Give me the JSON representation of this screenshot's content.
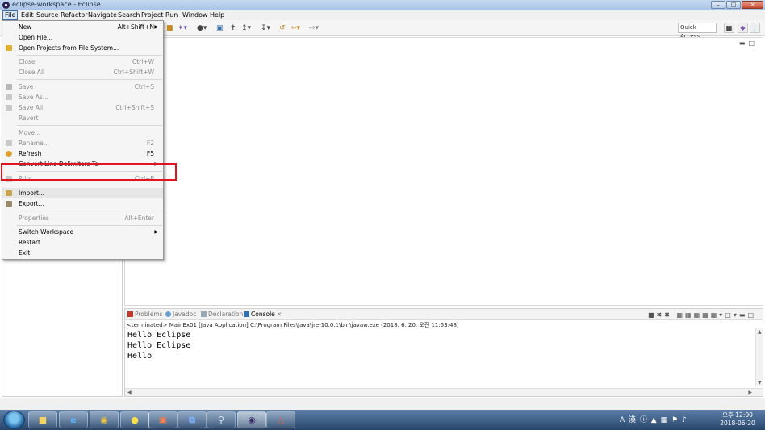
{
  "window": {
    "title": "eclipse-workspace - Eclipse"
  },
  "menubar": [
    "File",
    "Edit",
    "Source",
    "Refactor",
    "Navigate",
    "Search",
    "Project",
    "Run",
    "Window",
    "Help"
  ],
  "toolbar": {
    "quick_access": "Quick Access"
  },
  "file_menu": [
    {
      "label": "New",
      "shortcut": "Alt+Shift+N",
      "submenu": true,
      "disabled": false
    },
    {
      "label": "Open File...",
      "shortcut": "",
      "disabled": false
    },
    {
      "label": "Open Projects from File System...",
      "shortcut": "",
      "disabled": false
    },
    {
      "label": "Close",
      "shortcut": "Ctrl+W",
      "disabled": true
    },
    {
      "label": "Close All",
      "shortcut": "Ctrl+Shift+W",
      "disabled": true
    },
    {
      "label": "Save",
      "shortcut": "Ctrl+S",
      "disabled": true
    },
    {
      "label": "Save As...",
      "shortcut": "",
      "disabled": true
    },
    {
      "label": "Save All",
      "shortcut": "Ctrl+Shift+S",
      "disabled": true
    },
    {
      "label": "Revert",
      "shortcut": "",
      "disabled": true
    },
    {
      "label": "Move...",
      "shortcut": "",
      "disabled": true
    },
    {
      "label": "Rename...",
      "shortcut": "F2",
      "disabled": true
    },
    {
      "label": "Refresh",
      "shortcut": "F5",
      "disabled": false
    },
    {
      "label": "Convert Line Delimiters To",
      "shortcut": "",
      "submenu": true,
      "disabled": false
    },
    {
      "label": "Print...",
      "shortcut": "Ctrl+P",
      "disabled": true
    },
    {
      "label": "Import...",
      "shortcut": "",
      "disabled": false
    },
    {
      "label": "Export...",
      "shortcut": "",
      "disabled": false
    },
    {
      "label": "Properties",
      "shortcut": "Alt+Enter",
      "disabled": true
    },
    {
      "label": "Switch Workspace",
      "shortcut": "",
      "submenu": true,
      "disabled": false
    },
    {
      "label": "Restart",
      "shortcut": "",
      "disabled": false
    },
    {
      "label": "Exit",
      "shortcut": "",
      "disabled": false
    }
  ],
  "console": {
    "tabs": [
      "Problems",
      "Javadoc",
      "Declaration",
      "Console"
    ],
    "active_tab": "Console",
    "status": "<terminated> MainEx01 [Java Application] C:\\Program Files\\Java\\jre-10.0.1\\bin\\javaw.exe (2018. 6. 20. 오전 11:53:48)",
    "output": [
      "Hello Eclipse",
      "Hello Eclipse",
      "Hello"
    ]
  },
  "taskbar": {
    "apps": [
      "Windows Explorer",
      "Internet Explorer",
      "Google Chrome",
      "KakaoTalk",
      "Presentation",
      "Visual Studio",
      "Search",
      "Eclipse",
      "Adobe Acrobat"
    ],
    "tray": {
      "ime": "A 漢"
    },
    "clock": {
      "time": "오후 12:00",
      "date": "2018-06-20"
    }
  },
  "colors": {
    "highlight_box": "#e0141e",
    "menu_active": "#3d6fa8",
    "taskbar": "#27456a"
  }
}
